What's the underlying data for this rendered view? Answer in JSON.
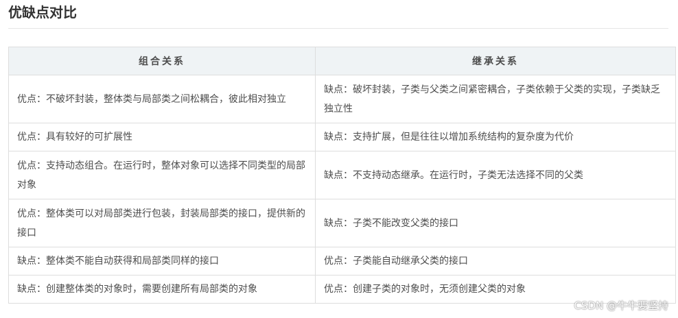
{
  "heading": "优缺点对比",
  "table": {
    "headers": [
      "组合关系",
      "继承关系"
    ],
    "rows": [
      [
        "优点：不破坏封装，整体类与局部类之间松耦合，彼此相对独立",
        "缺点：破坏封装，子类与父类之间紧密耦合，子类依赖于父类的实现，子类缺乏独立性"
      ],
      [
        "优点：具有较好的可扩展性",
        "缺点：支持扩展，但是往往以增加系统结构的复杂度为代价"
      ],
      [
        "优点：支持动态组合。在运行时，整体对象可以选择不同类型的局部对象",
        "缺点：不支持动态继承。在运行时，子类无法选择不同的父类"
      ],
      [
        "优点：整体类可以对局部类进行包装，封装局部类的接口，提供新的接口",
        "缺点：子类不能改变父类的接口"
      ],
      [
        "缺点：整体类不能自动获得和局部类同样的接口",
        "优点：子类能自动继承父类的接口"
      ],
      [
        "缺点：创建整体类的对象时，需要创建所有局部类的对象",
        "优点：创建子类的对象时，无须创建父类的对象"
      ]
    ]
  },
  "watermark": "CSDN @牛牛要坚持"
}
